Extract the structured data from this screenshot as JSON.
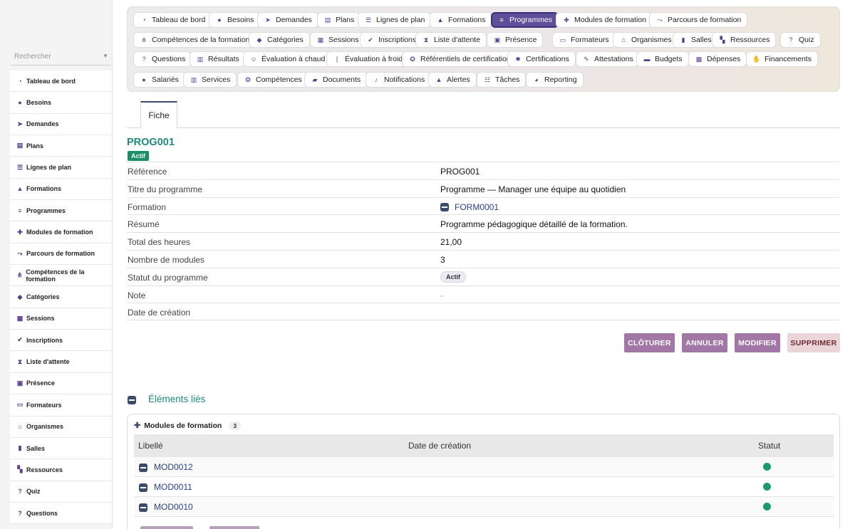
{
  "sidebar": {
    "search_placeholder": "Rechercher",
    "items": [
      {
        "label": "Tableau de bord",
        "icon": "dashboard-icon",
        "glyph": "◔"
      },
      {
        "label": "Besoins",
        "icon": "lightbulb-icon",
        "glyph": "●"
      },
      {
        "label": "Demandes",
        "icon": "paper-plane-icon",
        "glyph": "➤"
      },
      {
        "label": "Plans",
        "icon": "clipboard-icon",
        "glyph": "▤"
      },
      {
        "label": "Lignes de plan",
        "icon": "list-icon",
        "glyph": "☰"
      },
      {
        "label": "Formations",
        "icon": "graduation-cap-icon",
        "glyph": "▲"
      },
      {
        "label": "Programmes",
        "icon": "bars-icon",
        "glyph": "≡"
      },
      {
        "label": "Modules de formation",
        "icon": "puzzle-icon",
        "glyph": "✚"
      },
      {
        "label": "Parcours de formation",
        "icon": "route-icon",
        "glyph": "⤳"
      },
      {
        "label": "Compétences de la formation",
        "icon": "network-icon",
        "glyph": "⋔"
      },
      {
        "label": "Catégories",
        "icon": "tags-icon",
        "glyph": "◆"
      },
      {
        "label": "Sessions",
        "icon": "calendar-icon",
        "glyph": "▦"
      },
      {
        "label": "Inscriptions",
        "icon": "user-check-icon",
        "glyph": "✔"
      },
      {
        "label": "Liste d'attente",
        "icon": "hourglass-icon",
        "glyph": "⧗"
      },
      {
        "label": "Présence",
        "icon": "clipboard-check-icon",
        "glyph": "▣"
      },
      {
        "label": "Formateurs",
        "icon": "chalkboard-teacher-icon",
        "glyph": "▭"
      },
      {
        "label": "Organismes",
        "icon": "building-columns-icon",
        "glyph": "⌂"
      },
      {
        "label": "Salles",
        "icon": "door-icon",
        "glyph": "▮"
      },
      {
        "label": "Ressources",
        "icon": "boxes-icon",
        "glyph": "▚"
      },
      {
        "label": "Quiz",
        "icon": "question-circle-icon",
        "glyph": "?"
      },
      {
        "label": "Questions",
        "icon": "question-icon",
        "glyph": "?"
      }
    ]
  },
  "topnav": {
    "rows": [
      [
        {
          "label": "Tableau de bord",
          "icon": "dashboard-icon",
          "glyph": "◔"
        },
        {
          "label": "Besoins",
          "icon": "lightbulb-icon",
          "glyph": "●"
        },
        {
          "label": "Demandes",
          "icon": "paper-plane-icon",
          "glyph": "➤"
        },
        {
          "label": "Plans",
          "icon": "clipboard-icon",
          "glyph": "▤"
        },
        {
          "label": "Lignes de plan",
          "icon": "list-icon",
          "glyph": "☰"
        },
        {
          "label": "Formations",
          "icon": "graduation-cap-icon",
          "glyph": "▲"
        },
        {
          "label": "Programmes",
          "icon": "bars-icon",
          "glyph": "≡",
          "active": true
        },
        {
          "label": "Modules de formation",
          "icon": "puzzle-icon",
          "glyph": "✚"
        },
        {
          "label": "Parcours de formation",
          "icon": "route-icon",
          "glyph": "⤳"
        }
      ],
      [
        {
          "label": "Compétences de la formation",
          "icon": "network-icon",
          "glyph": "⋔"
        },
        {
          "label": "Catégories",
          "icon": "tags-icon",
          "glyph": "◆"
        },
        {
          "label": "Sessions",
          "icon": "calendar-icon",
          "glyph": "▦"
        },
        {
          "label": "Inscriptions",
          "icon": "user-check-icon",
          "glyph": "✔"
        },
        {
          "label": "Liste d'attente",
          "icon": "hourglass-icon",
          "glyph": "⧗"
        },
        {
          "label": "Présence",
          "icon": "clipboard-check-icon",
          "glyph": "▣"
        },
        {
          "label": "Formateurs",
          "icon": "chalkboard-teacher-icon",
          "glyph": "▭"
        },
        {
          "label": "Organismes",
          "icon": "building-columns-icon",
          "glyph": "⌂"
        },
        {
          "label": "Salles",
          "icon": "door-icon",
          "glyph": "▮"
        },
        {
          "label": "Ressources",
          "icon": "boxes-icon",
          "glyph": "▚"
        },
        {
          "label": "Quiz",
          "icon": "question-circle-icon",
          "glyph": "?"
        }
      ],
      [
        {
          "label": "Questions",
          "icon": "question-icon",
          "glyph": "?"
        },
        {
          "label": "Résultats",
          "icon": "poll-icon",
          "glyph": "▥"
        },
        {
          "label": "Évaluation à chaud",
          "icon": "smile-icon",
          "glyph": "☺"
        },
        {
          "label": "Évaluation à froid",
          "icon": "thermometer-icon",
          "glyph": "❘"
        },
        {
          "label": "Référentiels de certification",
          "icon": "award-icon",
          "glyph": "✪"
        },
        {
          "label": "Certifications",
          "icon": "certificate-icon",
          "glyph": "✹"
        },
        {
          "label": "Attestations",
          "icon": "file-signature-icon",
          "glyph": "✎"
        },
        {
          "label": "Budgets",
          "icon": "wallet-icon",
          "glyph": "▬"
        },
        {
          "label": "Dépenses",
          "icon": "money-bill-icon",
          "glyph": "▩"
        },
        {
          "label": "Financements",
          "icon": "hand-holding-usd-icon",
          "glyph": "✋"
        }
      ],
      [
        {
          "label": "Salariés",
          "icon": "users-icon",
          "glyph": "●"
        },
        {
          "label": "Services",
          "icon": "building-icon",
          "glyph": "▥"
        },
        {
          "label": "Compétences",
          "icon": "brain-icon",
          "glyph": "❂"
        },
        {
          "label": "Documents",
          "icon": "folder-open-icon",
          "glyph": "▰"
        },
        {
          "label": "Notifications",
          "icon": "bell-icon",
          "glyph": "♪"
        },
        {
          "label": "Alertes",
          "icon": "warning-icon",
          "glyph": "▲"
        },
        {
          "label": "Tâches",
          "icon": "tasks-icon",
          "glyph": "☷"
        },
        {
          "label": "Reporting",
          "icon": "chart-pie-icon",
          "glyph": "◕"
        }
      ]
    ]
  },
  "tabs": {
    "fiche": "Fiche"
  },
  "record": {
    "code": "PROG001",
    "status_badge": "Actif",
    "fields": [
      {
        "label": "Référence",
        "value": "PROG001"
      },
      {
        "label": "Titre du programme",
        "value": "Programme — Manager une équipe au quotidien"
      },
      {
        "label": "Formation",
        "value": "FORM0001",
        "type": "link"
      },
      {
        "label": "Résumé",
        "value": "Programme pédagogique détaillé de la formation."
      },
      {
        "label": "Total des heures",
        "value": "21,00"
      },
      {
        "label": "Nombre de modules",
        "value": "3"
      },
      {
        "label": "Statut du programme",
        "value": "Actif",
        "type": "chip"
      },
      {
        "label": "Note",
        "value": "-",
        "type": "dash"
      },
      {
        "label": "Date de création",
        "value": ""
      }
    ]
  },
  "actions": {
    "cloturer": "CLÔTURER",
    "annuler": "ANNULER",
    "modifier": "MODIFIER",
    "supprimer": "SUPPRIMER"
  },
  "related": {
    "title": "Éléments liés",
    "card_title": "Modules de formation",
    "count": "3",
    "columns": {
      "libelle": "Libellé",
      "date": "Date de création",
      "statut": "Statut"
    },
    "rows": [
      {
        "code": "MOD0012",
        "status": "active"
      },
      {
        "code": "MOD0011",
        "status": "active"
      },
      {
        "code": "MOD0010",
        "status": "active"
      }
    ]
  },
  "colors": {
    "accent": "#5e4f9b",
    "title_teal": "#1f8a7e",
    "success": "#1c8e66",
    "action_purple": "#a277a5",
    "danger_bg": "#ead6d9"
  }
}
